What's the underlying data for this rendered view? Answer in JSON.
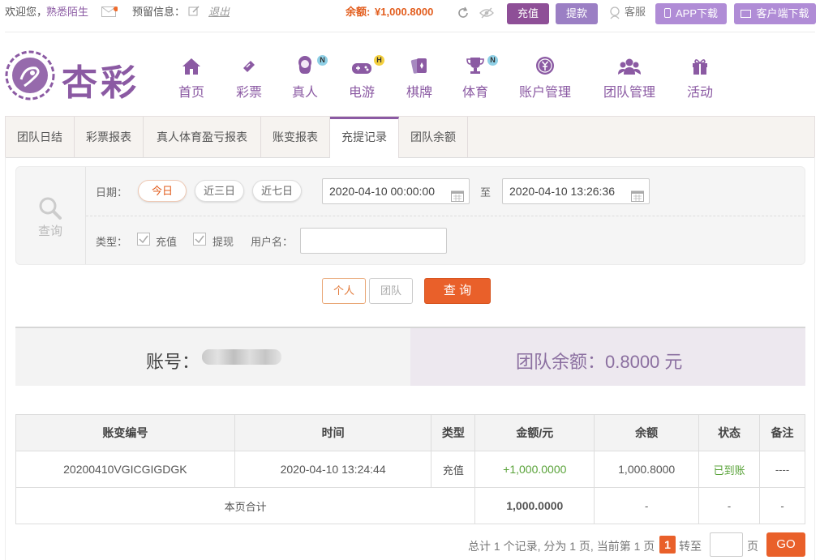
{
  "topbar": {
    "welcome": "欢迎您，",
    "username": "熟悉陌生",
    "reserved_label": "预留信息：",
    "logout": "退出",
    "balance_label": "余额:",
    "balance_value": "¥1,000.8000",
    "deposit_btn": "充值",
    "withdraw_btn": "提款",
    "service": "客服",
    "app_download": "APP下载",
    "client_download": "客户端下载"
  },
  "logo": {
    "text": "杏彩"
  },
  "nav": [
    {
      "label": "首页",
      "icon": "home-icon"
    },
    {
      "label": "彩票",
      "icon": "ticket-icon"
    },
    {
      "label": "真人",
      "icon": "live-dealer-icon",
      "badge": "N"
    },
    {
      "label": "电游",
      "icon": "gamepad-icon",
      "badge": "H"
    },
    {
      "label": "棋牌",
      "icon": "cards-icon"
    },
    {
      "label": "体育",
      "icon": "trophy-icon",
      "badge": "N"
    },
    {
      "label": "账户管理",
      "icon": "coin-icon"
    },
    {
      "label": "团队管理",
      "icon": "team-icon"
    },
    {
      "label": "活动",
      "icon": "gift-icon"
    }
  ],
  "tabs": [
    "团队日结",
    "彩票报表",
    "真人体育盈亏报表",
    "账变报表",
    "充提记录",
    "团队余额"
  ],
  "active_tab": "充提记录",
  "filter": {
    "search_label": "查询",
    "date_label": "日期：",
    "today": "今日",
    "three_days": "近三日",
    "seven_days": "近七日",
    "start_date": "2020-04-10 00:00:00",
    "to": "至",
    "end_date": "2020-04-10 13:26:36",
    "type_label": "类型：",
    "type_deposit": "充值",
    "type_withdraw": "提现",
    "username_label": "用户名：",
    "username_value": ""
  },
  "actions": {
    "personal": "个人",
    "team": "团队",
    "query": "查 询"
  },
  "summary": {
    "account_label": "账号：",
    "team_balance": "团队余额：0.8000 元"
  },
  "table": {
    "headers": [
      "账变编号",
      "时间",
      "类型",
      "金额/元",
      "余额",
      "状态",
      "备注"
    ],
    "rows": [
      [
        "20200410VGICGIGDGK",
        "2020-04-10 13:24:44",
        "充值",
        "+1,000.0000",
        "1,000.8000",
        "已到账",
        "----"
      ]
    ],
    "footer": {
      "label": "本页合计",
      "amount": "1,000.0000",
      "balance": "-",
      "status": "-",
      "note": "-"
    }
  },
  "pager": {
    "summary": "总计 1 个记录, 分为 1 页, 当前第 1 页",
    "current": "1",
    "goto": "转至",
    "page_unit": "页",
    "go": "GO"
  },
  "colors": {
    "brand": "#8b5aa3",
    "accent": "#e25d1d",
    "success": "#5aa33a"
  }
}
